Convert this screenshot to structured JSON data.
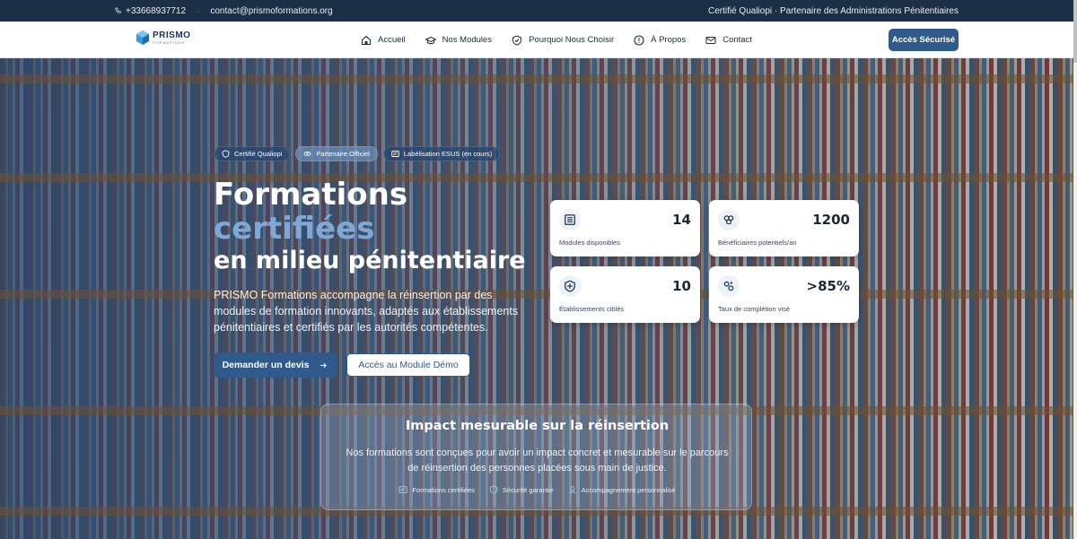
{
  "topbar": {
    "phone": "+33668937712",
    "email": "contact@prismoformations.org",
    "tagline": "Certifié Qualiopi · Partenaire des Administrations Pénitentiaires"
  },
  "nav": {
    "logo_text": "PRISMO",
    "logo_sub": "FORMATIONS",
    "items": [
      {
        "label": "Accueil",
        "icon": "home-icon"
      },
      {
        "label": "Nos Modules",
        "icon": "graduation-cap-icon"
      },
      {
        "label": "Pourquoi Nous Choisir",
        "icon": "shield-icon"
      },
      {
        "label": "À Propos",
        "icon": "info-icon"
      },
      {
        "label": "Contact",
        "icon": "envelope-icon"
      }
    ],
    "cta": "Accès Sécurisé"
  },
  "hero": {
    "badges": [
      {
        "label": "Certifié Qualiopi",
        "icon": "shield-check-icon"
      },
      {
        "label": "Partenaire Officiel",
        "icon": "handshake-icon"
      },
      {
        "label": "Labélisation ESUS (en cours)",
        "icon": "certificate-icon"
      }
    ],
    "title_line1": "Formations",
    "title_line2": "certifiées",
    "title_line3": "en milieu pénitentiaire",
    "lead": "PRISMO Formations accompagne la réinsertion par des modules de formation innovants, adaptés aux établissements pénitentiaires et certifiés par les autorités compétentes.",
    "primary_cta": "Demander un devis",
    "secondary_cta": "Accès au Module Démo"
  },
  "stats": [
    {
      "value": "14",
      "label": "Modules disponibles",
      "icon": "book-icon"
    },
    {
      "value": "1200",
      "label": "Bénéficiaires potentiels/an",
      "icon": "users-icon"
    },
    {
      "value": "10",
      "label": "Établissements ciblés",
      "icon": "shield-icon"
    },
    {
      "value": ">85%",
      "label": "Taux de complétion visé",
      "icon": "chart-icon"
    }
  ],
  "impact": {
    "title": "Impact mesurable sur la réinsertion",
    "description": "Nos formations sont conçues pour avoir un impact concret et mesurable sur le parcours de réinsertion des personnes placées sous main de justice.",
    "features": [
      {
        "label": "Formations certifiées",
        "icon": "certificate-icon"
      },
      {
        "label": "Sécurité garantie",
        "icon": "shield-icon"
      },
      {
        "label": "Accompagnement personnalisé",
        "icon": "user-support-icon"
      }
    ]
  },
  "colors": {
    "primary": "#2f5a8b",
    "topbar": "#1b2f47",
    "accent_text": "#7fa8d6"
  }
}
